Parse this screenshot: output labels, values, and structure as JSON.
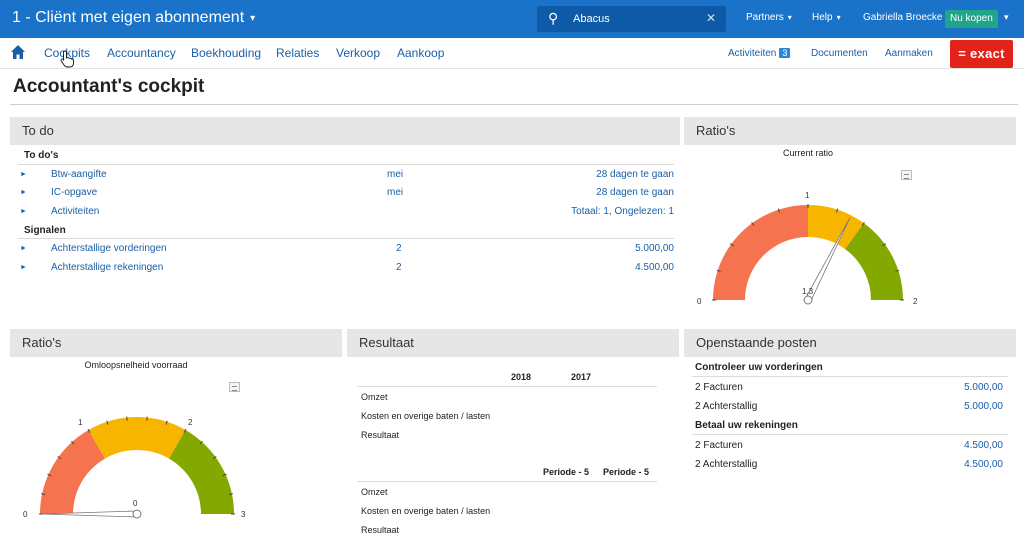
{
  "topbar": {
    "company": "1 - Cliënt met eigen abonnement",
    "search_value": "Abacus",
    "partners": "Partners",
    "help": "Help",
    "user": "Gabriella Broecke",
    "buy": "Nu kopen"
  },
  "menu": {
    "items": [
      "Cockpits",
      "Accountancy",
      "Boekhouding",
      "Relaties",
      "Verkoop",
      "Aankoop"
    ],
    "activiteiten": "Activiteiten",
    "activiteiten_count": "3",
    "documenten": "Documenten",
    "aanmaken": "Aanmaken",
    "brand": "= exact"
  },
  "page": {
    "title": "Accountant's cockpit"
  },
  "todo": {
    "header": "To do",
    "section1": "To do's",
    "rows1": [
      {
        "label": "Btw-aangifte",
        "mid": "mei",
        "right": "28 dagen te gaan"
      },
      {
        "label": "IC-opgave",
        "mid": "mei",
        "right": "28 dagen te gaan"
      },
      {
        "label": "Activiteiten",
        "mid": "",
        "right": "Totaal: 1, Ongelezen: 1"
      }
    ],
    "section2": "Signalen",
    "rows2": [
      {
        "label": "Achterstallige vorderingen",
        "mid": "2",
        "right": "5.000,00"
      },
      {
        "label": "Achterstallige rekeningen",
        "mid": "2",
        "right": "4.500,00"
      }
    ]
  },
  "ratio1": {
    "header": "Ratio's",
    "title": "Current ratio",
    "min": "0",
    "max": "2",
    "mid_tick": "1",
    "value_label": "1,3",
    "value": 1.3,
    "range": [
      0,
      2
    ],
    "bands": [
      {
        "from": 0,
        "to": 1.0,
        "color": "#f5734f"
      },
      {
        "from": 1.0,
        "to": 1.4,
        "color": "#f7b500"
      },
      {
        "from": 1.4,
        "to": 2.0,
        "color": "#84a800"
      }
    ]
  },
  "ratio2": {
    "header": "Ratio's",
    "title": "Omloopsnelheid voorraad",
    "min": "0",
    "max": "3",
    "tick1": "1",
    "tick2": "2",
    "value_label": "0",
    "value": 0,
    "range": [
      0,
      3
    ],
    "bands": [
      {
        "from": 0,
        "to": 1.0,
        "color": "#f5734f"
      },
      {
        "from": 1.0,
        "to": 2.0,
        "color": "#f7b500"
      },
      {
        "from": 2.0,
        "to": 3.0,
        "color": "#84a800"
      }
    ]
  },
  "resultaat": {
    "header": "Resultaat",
    "col1": "2018",
    "col2": "2017",
    "rows": [
      "Omzet",
      "Kosten en overige baten / lasten",
      "Resultaat"
    ],
    "pcol1": "Periode - 5",
    "pcol2": "Periode - 5",
    "prows": [
      "Omzet",
      "Kosten en overige baten / lasten",
      "Resultaat"
    ]
  },
  "open": {
    "header": "Openstaande posten",
    "section1": "Controleer uw vorderingen",
    "rows1": [
      {
        "label": "2 Facturen",
        "value": "5.000,00"
      },
      {
        "label": "2 Achterstallig",
        "value": "5.000,00"
      }
    ],
    "section2": "Betaal uw rekeningen",
    "rows2": [
      {
        "label": "2 Facturen",
        "value": "4.500,00"
      },
      {
        "label": "2 Achterstallig",
        "value": "4.500,00"
      }
    ]
  },
  "colors": {
    "topbar": "#1a73c8",
    "link": "#1a5fa6",
    "exact_red": "#e2231a",
    "buy_green": "#20a58a"
  }
}
